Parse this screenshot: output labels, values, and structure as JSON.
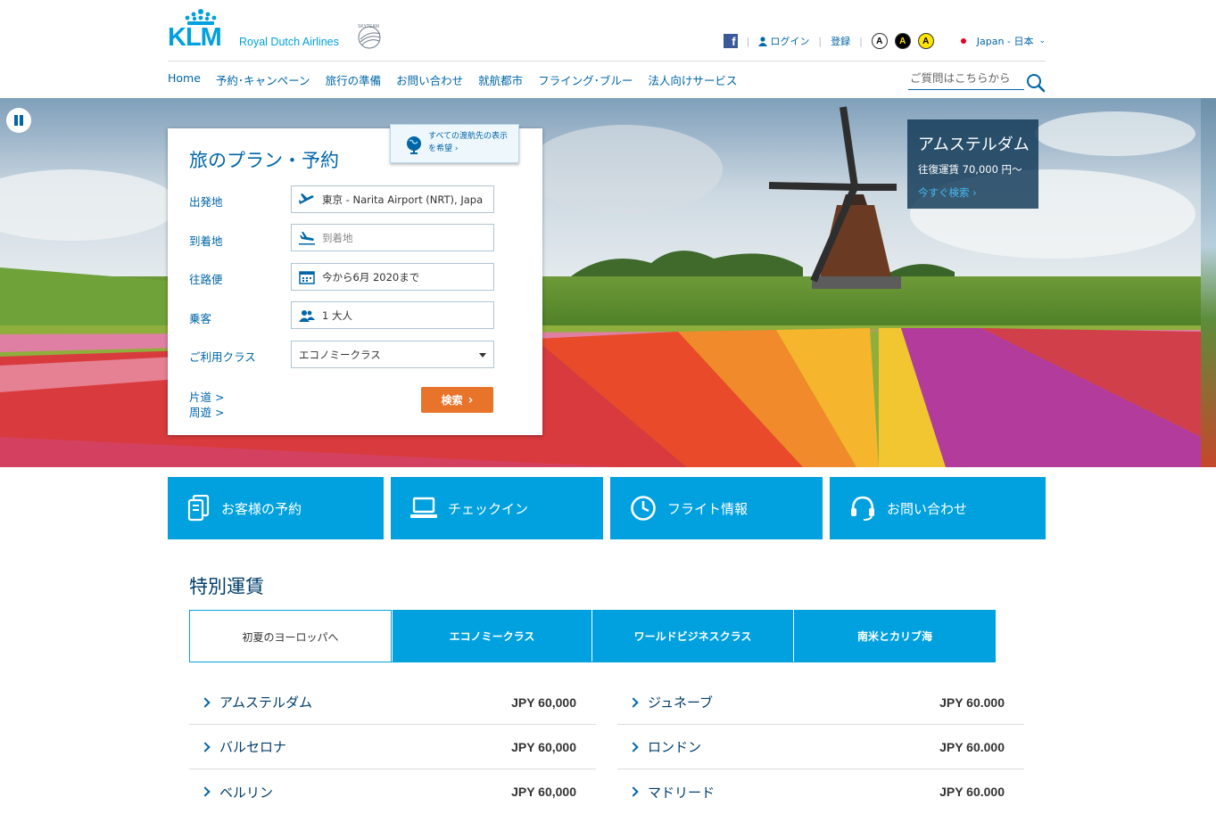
{
  "brand": {
    "logo_text": "KLM",
    "tagline": "Royal Dutch Airlines",
    "alliance_mark": "SKYTEAM",
    "color": "#00a1de"
  },
  "utility": {
    "login": "ログイン",
    "register": "登録",
    "contrast_a": "A",
    "language": "Japan - 日本"
  },
  "nav": {
    "items": [
      "Home",
      "予約･キャンペーン",
      "旅行の準備",
      "お問い合わせ",
      "就航都市",
      "フライング･ブルー",
      "法人向けサービス"
    ],
    "search_placeholder": "ご質問はこちらから"
  },
  "booking": {
    "title": "旅のプラン・予約",
    "destinations_tip": [
      "すべての渡航先の表示",
      "を希望"
    ],
    "labels": {
      "origin": "出発地",
      "destination": "到着地",
      "outbound": "往路便",
      "passengers": "乗客",
      "cabin": "ご利用クラス"
    },
    "origin_value": "東京 - Narita Airport (NRT), Japa",
    "destination_placeholder": "到着地",
    "date_value": "今から6月 2020まで",
    "passengers_value": "1 大人",
    "cabin_value": "エコノミークラス",
    "one_way": "片道 >",
    "open_jaw": "周遊 >",
    "search_label": "検索"
  },
  "promo": {
    "city": "アムステルダム",
    "fare": "往復運賃 70,000 円～",
    "cta": "今すぐ検索"
  },
  "quick_tiles": [
    "お客様の予約",
    "チェックイン",
    "フライト情報",
    "お問い合わせ"
  ],
  "special_fares": {
    "title": "特別運賃",
    "tabs": [
      "初夏のヨーロッパへ",
      "エコノミークラス",
      "ワールドビジネスクラス",
      "南米とカリブ海"
    ],
    "left": [
      {
        "city": "アムステルダム",
        "price": "JPY 60,000"
      },
      {
        "city": "バルセロナ",
        "price": "JPY 60,000"
      },
      {
        "city": "ベルリン",
        "price": "JPY 60,000"
      }
    ],
    "right": [
      {
        "city": "ジュネーブ",
        "price": "JPY 60.000"
      },
      {
        "city": "ロンドン",
        "price": "JPY 60.000"
      },
      {
        "city": "マドリード",
        "price": "JPY 60.000"
      }
    ]
  },
  "colors": {
    "accent": "#00a1de",
    "link": "#0066a8",
    "search_button": "#e8732a"
  }
}
